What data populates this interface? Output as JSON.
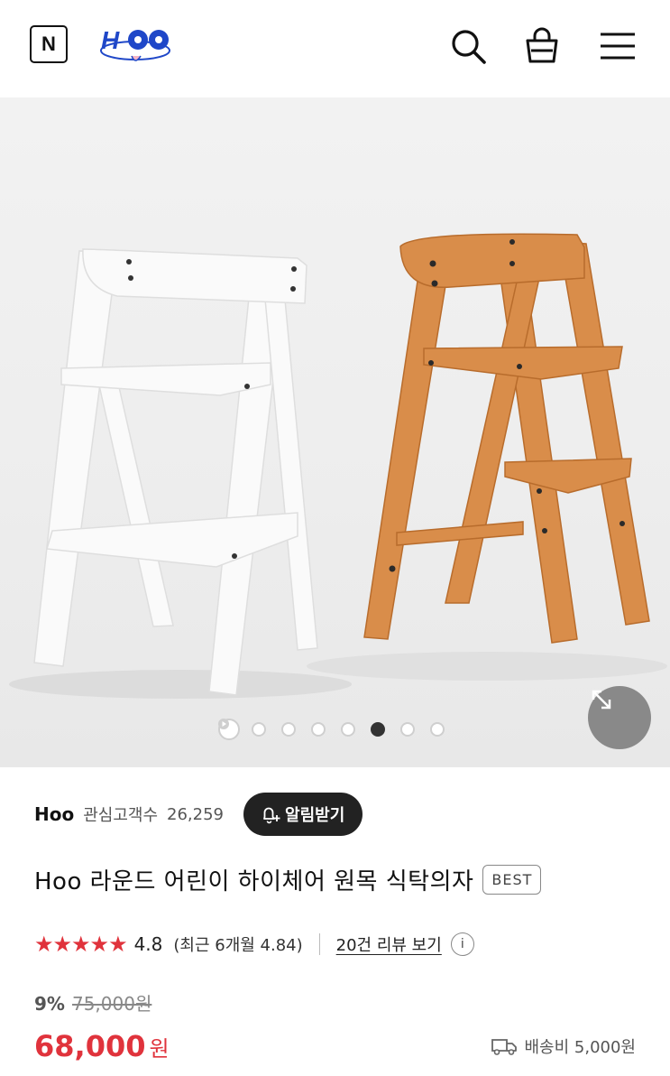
{
  "header": {
    "n_label": "N",
    "logo_text": "Hoo",
    "icons": [
      "search-icon",
      "shopping-bag-icon",
      "hamburger-menu-icon"
    ]
  },
  "gallery": {
    "slide_count": 8,
    "active_index": 5,
    "first_is_video": true,
    "expand_icon": "expand-arrows-icon"
  },
  "brand": {
    "name": "Hoo",
    "fan_label": "관심고객수",
    "fan_count": "26,259",
    "notify_label": "알림받기"
  },
  "product": {
    "title": "Hoo 라운드 어린이 하이체어 원목 식탁의자",
    "badge": "BEST",
    "stars": "★★★★★",
    "rating": "4.8",
    "recent_rating": "(최근 6개월 4.84)",
    "review_link": "20건 리뷰 보기",
    "info_icon": "i",
    "discount": "9%",
    "original_price": "75,000원",
    "price": "68,000",
    "currency": "원",
    "shipping": "배송비 5,000원"
  },
  "colors": {
    "accent_red": "#e0333c",
    "dark": "#222222"
  }
}
